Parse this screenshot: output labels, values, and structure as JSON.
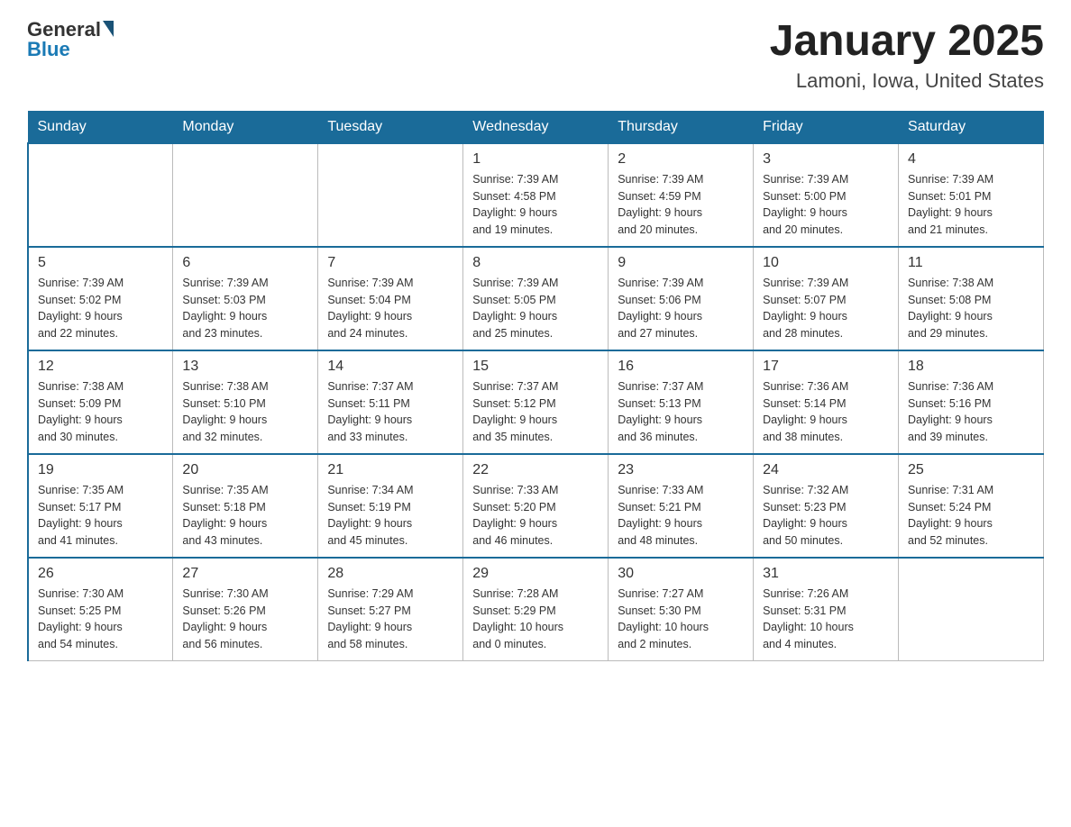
{
  "logo": {
    "general": "General",
    "blue": "Blue"
  },
  "title": {
    "month_year": "January 2025",
    "location": "Lamoni, Iowa, United States"
  },
  "days_of_week": [
    "Sunday",
    "Monday",
    "Tuesday",
    "Wednesday",
    "Thursday",
    "Friday",
    "Saturday"
  ],
  "weeks": [
    [
      {
        "day": "",
        "info": ""
      },
      {
        "day": "",
        "info": ""
      },
      {
        "day": "",
        "info": ""
      },
      {
        "day": "1",
        "info": "Sunrise: 7:39 AM\nSunset: 4:58 PM\nDaylight: 9 hours\nand 19 minutes."
      },
      {
        "day": "2",
        "info": "Sunrise: 7:39 AM\nSunset: 4:59 PM\nDaylight: 9 hours\nand 20 minutes."
      },
      {
        "day": "3",
        "info": "Sunrise: 7:39 AM\nSunset: 5:00 PM\nDaylight: 9 hours\nand 20 minutes."
      },
      {
        "day": "4",
        "info": "Sunrise: 7:39 AM\nSunset: 5:01 PM\nDaylight: 9 hours\nand 21 minutes."
      }
    ],
    [
      {
        "day": "5",
        "info": "Sunrise: 7:39 AM\nSunset: 5:02 PM\nDaylight: 9 hours\nand 22 minutes."
      },
      {
        "day": "6",
        "info": "Sunrise: 7:39 AM\nSunset: 5:03 PM\nDaylight: 9 hours\nand 23 minutes."
      },
      {
        "day": "7",
        "info": "Sunrise: 7:39 AM\nSunset: 5:04 PM\nDaylight: 9 hours\nand 24 minutes."
      },
      {
        "day": "8",
        "info": "Sunrise: 7:39 AM\nSunset: 5:05 PM\nDaylight: 9 hours\nand 25 minutes."
      },
      {
        "day": "9",
        "info": "Sunrise: 7:39 AM\nSunset: 5:06 PM\nDaylight: 9 hours\nand 27 minutes."
      },
      {
        "day": "10",
        "info": "Sunrise: 7:39 AM\nSunset: 5:07 PM\nDaylight: 9 hours\nand 28 minutes."
      },
      {
        "day": "11",
        "info": "Sunrise: 7:38 AM\nSunset: 5:08 PM\nDaylight: 9 hours\nand 29 minutes."
      }
    ],
    [
      {
        "day": "12",
        "info": "Sunrise: 7:38 AM\nSunset: 5:09 PM\nDaylight: 9 hours\nand 30 minutes."
      },
      {
        "day": "13",
        "info": "Sunrise: 7:38 AM\nSunset: 5:10 PM\nDaylight: 9 hours\nand 32 minutes."
      },
      {
        "day": "14",
        "info": "Sunrise: 7:37 AM\nSunset: 5:11 PM\nDaylight: 9 hours\nand 33 minutes."
      },
      {
        "day": "15",
        "info": "Sunrise: 7:37 AM\nSunset: 5:12 PM\nDaylight: 9 hours\nand 35 minutes."
      },
      {
        "day": "16",
        "info": "Sunrise: 7:37 AM\nSunset: 5:13 PM\nDaylight: 9 hours\nand 36 minutes."
      },
      {
        "day": "17",
        "info": "Sunrise: 7:36 AM\nSunset: 5:14 PM\nDaylight: 9 hours\nand 38 minutes."
      },
      {
        "day": "18",
        "info": "Sunrise: 7:36 AM\nSunset: 5:16 PM\nDaylight: 9 hours\nand 39 minutes."
      }
    ],
    [
      {
        "day": "19",
        "info": "Sunrise: 7:35 AM\nSunset: 5:17 PM\nDaylight: 9 hours\nand 41 minutes."
      },
      {
        "day": "20",
        "info": "Sunrise: 7:35 AM\nSunset: 5:18 PM\nDaylight: 9 hours\nand 43 minutes."
      },
      {
        "day": "21",
        "info": "Sunrise: 7:34 AM\nSunset: 5:19 PM\nDaylight: 9 hours\nand 45 minutes."
      },
      {
        "day": "22",
        "info": "Sunrise: 7:33 AM\nSunset: 5:20 PM\nDaylight: 9 hours\nand 46 minutes."
      },
      {
        "day": "23",
        "info": "Sunrise: 7:33 AM\nSunset: 5:21 PM\nDaylight: 9 hours\nand 48 minutes."
      },
      {
        "day": "24",
        "info": "Sunrise: 7:32 AM\nSunset: 5:23 PM\nDaylight: 9 hours\nand 50 minutes."
      },
      {
        "day": "25",
        "info": "Sunrise: 7:31 AM\nSunset: 5:24 PM\nDaylight: 9 hours\nand 52 minutes."
      }
    ],
    [
      {
        "day": "26",
        "info": "Sunrise: 7:30 AM\nSunset: 5:25 PM\nDaylight: 9 hours\nand 54 minutes."
      },
      {
        "day": "27",
        "info": "Sunrise: 7:30 AM\nSunset: 5:26 PM\nDaylight: 9 hours\nand 56 minutes."
      },
      {
        "day": "28",
        "info": "Sunrise: 7:29 AM\nSunset: 5:27 PM\nDaylight: 9 hours\nand 58 minutes."
      },
      {
        "day": "29",
        "info": "Sunrise: 7:28 AM\nSunset: 5:29 PM\nDaylight: 10 hours\nand 0 minutes."
      },
      {
        "day": "30",
        "info": "Sunrise: 7:27 AM\nSunset: 5:30 PM\nDaylight: 10 hours\nand 2 minutes."
      },
      {
        "day": "31",
        "info": "Sunrise: 7:26 AM\nSunset: 5:31 PM\nDaylight: 10 hours\nand 4 minutes."
      },
      {
        "day": "",
        "info": ""
      }
    ]
  ]
}
